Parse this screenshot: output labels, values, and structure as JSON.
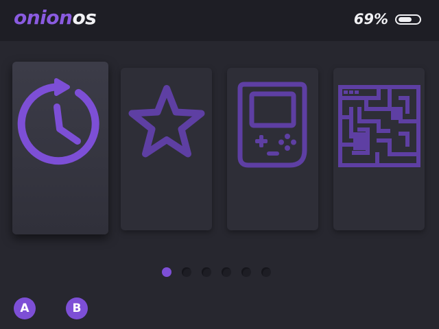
{
  "header": {
    "logo_part1": "onion",
    "logo_part2": "os",
    "battery_percent_label": "69%",
    "battery_level": 0.69
  },
  "carousel": {
    "items": [
      {
        "icon": "recent-history-icon",
        "selected": true
      },
      {
        "icon": "star-favorites-icon",
        "selected": false
      },
      {
        "icon": "gameboy-console-icon",
        "selected": false
      },
      {
        "icon": "maze-icon",
        "selected": false
      }
    ],
    "page_count": 6,
    "current_page": 1
  },
  "buttons": {
    "a_label": "A",
    "b_label": "B"
  },
  "colors": {
    "accent": "#7d4fd6",
    "icon_dim": "#5e3fa3",
    "background": "#27272f",
    "topbar": "#1e1e25",
    "text": "#f1f1f4"
  }
}
